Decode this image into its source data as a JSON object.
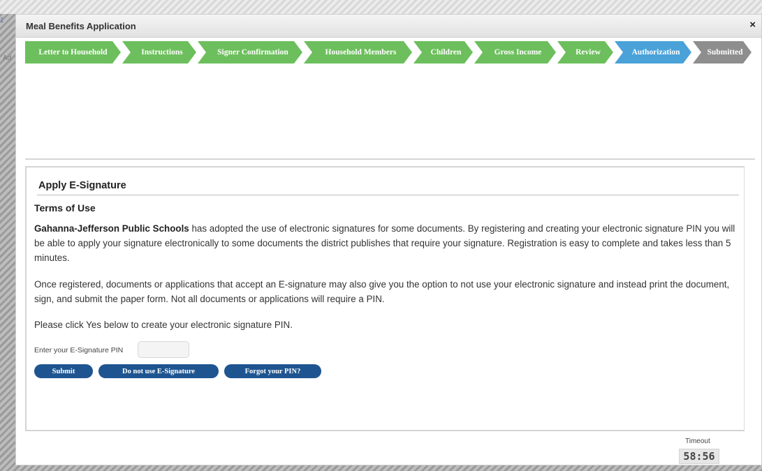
{
  "background": {
    "left_text_1": "1",
    "left_text_2": "Ad"
  },
  "dialog": {
    "title": "Meal Benefits Application",
    "close_label": "×"
  },
  "steps": [
    {
      "label": "Letter to Household",
      "status": "done"
    },
    {
      "label": "Instructions",
      "status": "done"
    },
    {
      "label": "Signer Confirmation",
      "status": "done"
    },
    {
      "label": "Household Members",
      "status": "done"
    },
    {
      "label": "Children",
      "status": "done"
    },
    {
      "label": "Gross Income",
      "status": "done"
    },
    {
      "label": "Review",
      "status": "done"
    },
    {
      "label": "Authorization",
      "status": "current"
    },
    {
      "label": "Submitted",
      "status": "todo"
    }
  ],
  "panel": {
    "header": "Apply E-Signature",
    "terms_heading": "Terms of Use",
    "paragraph1_bold": "Gahanna-Jefferson Public Schools",
    "paragraph1_rest": " has adopted the use of electronic signatures for some documents. By registering and creating your electronic signature PIN you will be able to apply your signature electronically to some documents the district publishes that require your signature. Registration is easy to complete and takes less than 5 minutes.",
    "paragraph2": "Once registered, documents or applications that accept an E-signature may also give you the option to not use your electronic signature and instead print the document, sign, and submit the paper form. Not all documents or applications will require a PIN.",
    "paragraph3": "Please click Yes below to create your electronic signature PIN.",
    "pin_label": "Enter your E-Signature PIN",
    "pin_value": "",
    "pin_placeholder": "",
    "buttons": {
      "submit": "Submit",
      "no_esig": "Do not use E-Signature",
      "forgot": "Forgot your PIN?"
    }
  },
  "timeout": {
    "label": "Timeout",
    "value": "58:56"
  },
  "colors": {
    "step_done": "#6cbf5c",
    "step_current": "#4aa2d9",
    "step_todo": "#8e8e8e",
    "button": "#1e5591"
  }
}
